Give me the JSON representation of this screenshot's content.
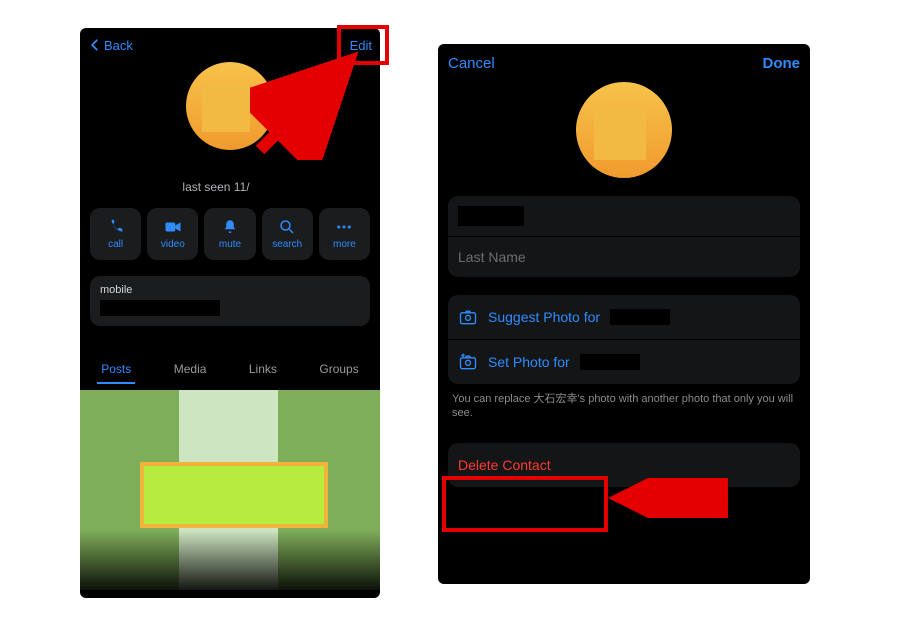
{
  "left": {
    "nav": {
      "back": "Back",
      "edit": "Edit"
    },
    "last_seen_prefix": "last seen 11/",
    "actions": {
      "call": {
        "label": "call",
        "icon": "phone-icon"
      },
      "video": {
        "label": "video",
        "icon": "video-icon"
      },
      "mute": {
        "label": "mute",
        "icon": "bell-icon"
      },
      "search": {
        "label": "search",
        "icon": "search-icon"
      },
      "more": {
        "label": "more",
        "icon": "more-icon"
      }
    },
    "mobile_label": "mobile",
    "tabs": {
      "posts": "Posts",
      "media": "Media",
      "links": "Links",
      "groups": "Groups",
      "active": "posts"
    }
  },
  "right": {
    "nav": {
      "cancel": "Cancel",
      "done": "Done"
    },
    "last_name_placeholder": "Last Name",
    "suggest_photo": "Suggest Photo for",
    "set_photo": "Set Photo for",
    "hint": "You can replace 大石宏幸's photo with another photo that only you will see.",
    "delete": "Delete Contact"
  }
}
